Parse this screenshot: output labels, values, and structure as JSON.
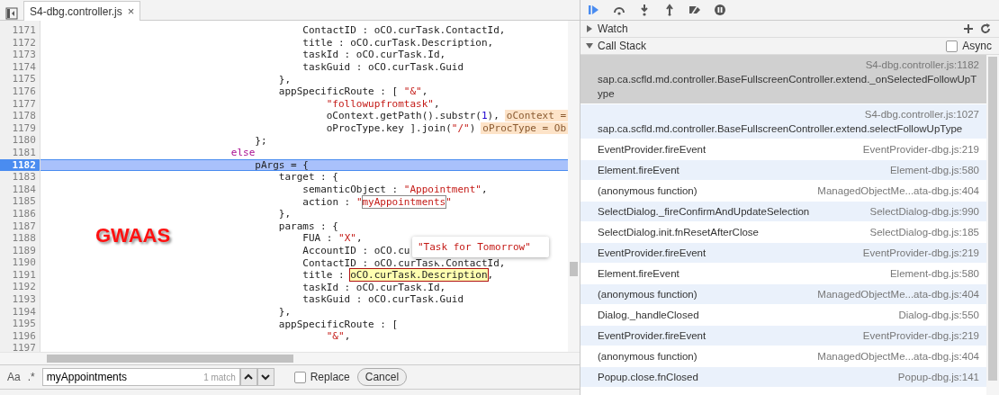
{
  "editor": {
    "tab": {
      "title": "S4-dbg.controller.js",
      "close": "×"
    },
    "lines": [
      {
        "number": "1171",
        "current": false,
        "segments": [
          {
            "text": "                                            ContactID : oCO.curTask.ContactId,",
            "kind": "plain"
          }
        ]
      },
      {
        "number": "1172",
        "current": false,
        "segments": [
          {
            "text": "                                            title : oCO.curTask.Description,",
            "kind": "plain"
          }
        ]
      },
      {
        "number": "1173",
        "current": false,
        "segments": [
          {
            "text": "                                            taskId : oCO.curTask.Id,",
            "kind": "plain"
          }
        ]
      },
      {
        "number": "1174",
        "current": false,
        "segments": [
          {
            "text": "                                            taskGuid : oCO.curTask.Guid",
            "kind": "plain"
          }
        ]
      },
      {
        "number": "1175",
        "current": false,
        "segments": [
          {
            "text": "                                        },",
            "kind": "plain"
          }
        ]
      },
      {
        "number": "1176",
        "current": false,
        "segments": [
          {
            "text": "                                        appSpecificRoute : [ ",
            "kind": "plain"
          },
          {
            "text": "\"&\"",
            "kind": "string"
          },
          {
            "text": ",",
            "kind": "plain"
          }
        ]
      },
      {
        "number": "1177",
        "current": false,
        "segments": [
          {
            "text": "                                                \"followupfromtask\"",
            "kind": "string"
          },
          {
            "text": ",",
            "kind": "plain"
          }
        ]
      },
      {
        "number": "1178",
        "current": false,
        "segments": [
          {
            "text": "                                                oContext.getPath().substr(",
            "kind": "plain"
          },
          {
            "text": "1",
            "kind": "number"
          },
          {
            "text": "),",
            "kind": "plain"
          }
        ],
        "hint": "oContext ="
      },
      {
        "number": "1179",
        "current": false,
        "segments": [
          {
            "text": "                                                oProcType.key ].join(",
            "kind": "plain"
          },
          {
            "text": "\"/\"",
            "kind": "string"
          },
          {
            "text": ")",
            "kind": "plain"
          }
        ],
        "hint": "oProcType = Ob"
      },
      {
        "number": "1180",
        "current": false,
        "segments": [
          {
            "text": "                                    };",
            "kind": "plain"
          }
        ]
      },
      {
        "number": "1181",
        "current": false,
        "segments": [
          {
            "text": "                                else",
            "kind": "keyword"
          }
        ]
      },
      {
        "number": "1182",
        "current": true,
        "segments": [
          {
            "text": "                                    pArgs = {",
            "kind": "plain"
          }
        ]
      },
      {
        "number": "1183",
        "current": false,
        "segments": [
          {
            "text": "                                        target : {",
            "kind": "plain"
          }
        ]
      },
      {
        "number": "1184",
        "current": false,
        "segments": [
          {
            "text": "                                            semanticObject : ",
            "kind": "plain"
          },
          {
            "text": "\"Appointment\"",
            "kind": "string"
          },
          {
            "text": ",",
            "kind": "plain"
          }
        ]
      },
      {
        "number": "1185",
        "current": false,
        "segments": [
          {
            "text": "                                            action : ",
            "kind": "plain"
          },
          {
            "text": "\"",
            "kind": "string"
          },
          {
            "text": "myAppointments",
            "kind": "match"
          },
          {
            "text": "\"",
            "kind": "string"
          }
        ]
      },
      {
        "number": "1186",
        "current": false,
        "segments": [
          {
            "text": "                                        },",
            "kind": "plain"
          }
        ]
      },
      {
        "number": "1187",
        "current": false,
        "segments": [
          {
            "text": "                                        params : {",
            "kind": "plain"
          }
        ]
      },
      {
        "number": "1188",
        "current": false,
        "segments": [
          {
            "text": "                                            FUA : ",
            "kind": "plain"
          },
          {
            "text": "\"X\"",
            "kind": "string"
          },
          {
            "text": ",",
            "kind": "plain"
          }
        ]
      },
      {
        "number": "1189",
        "current": false,
        "segments": [
          {
            "text": "                                            AccountID : oCO.cu",
            "kind": "plain"
          }
        ]
      },
      {
        "number": "1190",
        "current": false,
        "segments": [
          {
            "text": "                                            ContactID : oCO.curTask.ContactId,",
            "kind": "plain"
          }
        ]
      },
      {
        "number": "1191",
        "current": false,
        "segments": [
          {
            "text": "                                            title : ",
            "kind": "plain"
          },
          {
            "text": "oCO.curTask.Description",
            "kind": "hover"
          },
          {
            "text": ",",
            "kind": "plain"
          }
        ]
      },
      {
        "number": "1192",
        "current": false,
        "segments": [
          {
            "text": "                                            taskId : oCO.curTask.Id,",
            "kind": "plain"
          }
        ]
      },
      {
        "number": "1193",
        "current": false,
        "segments": [
          {
            "text": "                                            taskGuid : oCO.curTask.Guid",
            "kind": "plain"
          }
        ]
      },
      {
        "number": "1194",
        "current": false,
        "segments": [
          {
            "text": "                                        },",
            "kind": "plain"
          }
        ]
      },
      {
        "number": "1195",
        "current": false,
        "segments": [
          {
            "text": "                                        appSpecificRoute : [",
            "kind": "plain"
          }
        ]
      },
      {
        "number": "1196",
        "current": false,
        "segments": [
          {
            "text": "                                                \"&\"",
            "kind": "string"
          },
          {
            "text": ",",
            "kind": "plain"
          }
        ]
      },
      {
        "number": "1197",
        "current": false
      }
    ],
    "tooltip": "\"Task for Tomorrow\"",
    "annotation": "GWAAS",
    "search": {
      "case_toggle": "Aa",
      "regex_toggle": ".*",
      "value": "myAppointments",
      "match_count": "1 match",
      "replace": {
        "label": "Replace",
        "checked": false
      },
      "cancel": "Cancel"
    }
  },
  "debugger": {
    "watch": {
      "label": "Watch",
      "expanded": false
    },
    "call_stack": {
      "label": "Call Stack",
      "expanded": true,
      "async": {
        "label": "Async",
        "checked": false
      },
      "frames": [
        {
          "kind": "stacked",
          "name": "sap.ca.scfld.md.controller.BaseFullscreenController.extend._onSelectedFollowUpType",
          "location": "S4-dbg.controller.js:1182",
          "selected": true
        },
        {
          "kind": "stacked",
          "name": "sap.ca.scfld.md.controller.BaseFullscreenController.extend.selectFollowUpType",
          "location": "S4-dbg.controller.js:1027",
          "selected": false
        },
        {
          "name": "EventProvider.fireEvent",
          "location": "EventProvider-dbg.js:219",
          "selected": false
        },
        {
          "name": "Element.fireEvent",
          "location": "Element-dbg.js:580",
          "selected": false
        },
        {
          "name": "(anonymous function)",
          "location": "ManagedObjectMe...ata-dbg.js:404",
          "selected": false
        },
        {
          "name": "SelectDialog._fireConfirmAndUpdateSelection",
          "location": "SelectDialog-dbg.js:990",
          "selected": false
        },
        {
          "name": "SelectDialog.init.fnResetAfterClose",
          "location": "SelectDialog-dbg.js:185",
          "selected": false
        },
        {
          "name": "EventProvider.fireEvent",
          "location": "EventProvider-dbg.js:219",
          "selected": false
        },
        {
          "name": "Element.fireEvent",
          "location": "Element-dbg.js:580",
          "selected": false
        },
        {
          "name": "(anonymous function)",
          "location": "ManagedObjectMe...ata-dbg.js:404",
          "selected": false
        },
        {
          "name": "Dialog._handleClosed",
          "location": "Dialog-dbg.js:550",
          "selected": false
        },
        {
          "name": "EventProvider.fireEvent",
          "location": "EventProvider-dbg.js:219",
          "selected": false
        },
        {
          "name": "(anonymous function)",
          "location": "ManagedObjectMe...ata-dbg.js:404",
          "selected": false
        },
        {
          "name": "Popup.close.fnClosed",
          "location": "Popup-dbg.js:141",
          "selected": false
        }
      ]
    }
  }
}
